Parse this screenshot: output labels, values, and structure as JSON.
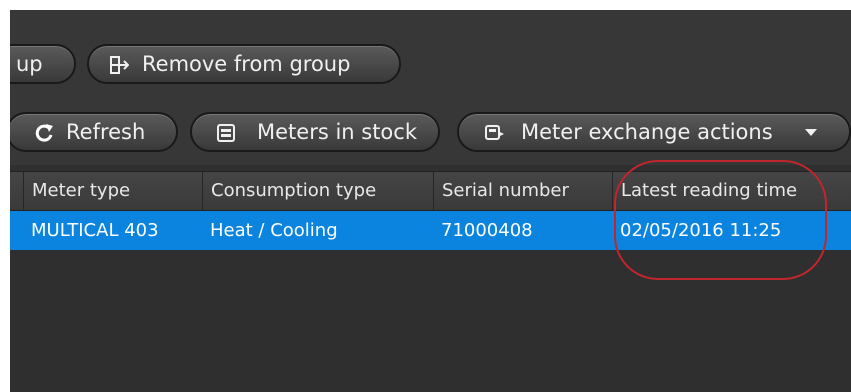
{
  "toolbar": {
    "row1": [
      {
        "label": "up",
        "icon": "add-to-group-icon"
      },
      {
        "label": "Remove from group",
        "icon": "remove-from-group-icon"
      }
    ],
    "row2": [
      {
        "label": "Refresh",
        "icon": "refresh-icon"
      },
      {
        "label": "Meters in stock",
        "icon": "meters-in-stock-icon"
      },
      {
        "label": "Meter exchange actions",
        "icon": "meter-exchange-icon",
        "dropdown": true
      }
    ]
  },
  "grid": {
    "columns": [
      "Meter type",
      "Consumption type",
      "Serial number",
      "Latest reading time"
    ],
    "rows": [
      {
        "selected": true,
        "cells": [
          "MULTICAL 403",
          "Heat / Cooling",
          "71000408",
          "02/05/2016 11:25"
        ]
      }
    ]
  },
  "colors": {
    "background": "#2f2f2f",
    "selection": "#0b84e0",
    "annotation": "#c0262c"
  }
}
